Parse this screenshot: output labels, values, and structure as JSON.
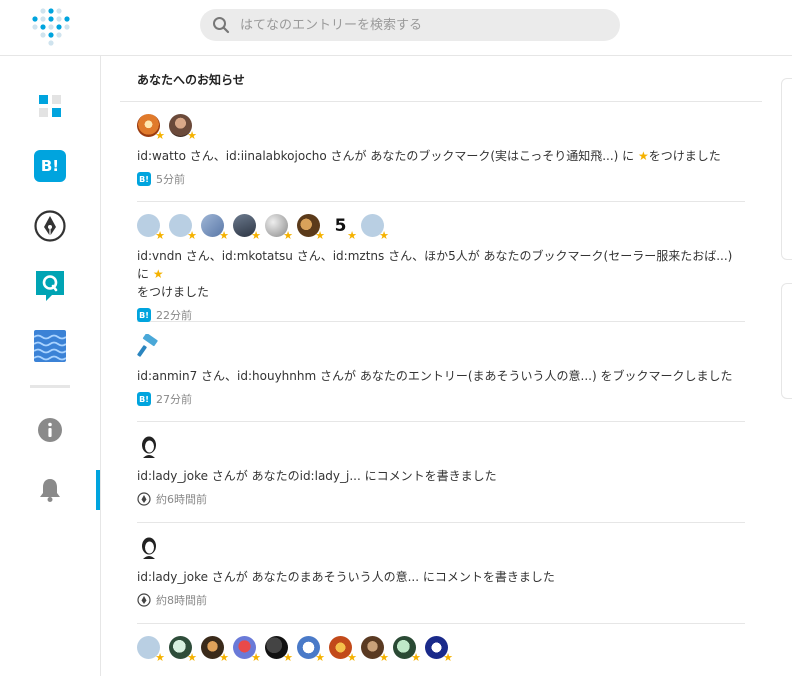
{
  "header": {
    "logo_icon": "hatena-dots-logo",
    "search_placeholder": "はてなのエントリーを検索する",
    "search_icon": "search-icon"
  },
  "sidebar": {
    "items": [
      {
        "name": "top",
        "icon": "hatena-top-icon"
      },
      {
        "name": "bookmark",
        "icon": "hatena-bookmark-icon"
      },
      {
        "name": "blog",
        "icon": "pen-nib-icon"
      },
      {
        "name": "question",
        "icon": "hatena-question-icon"
      },
      {
        "name": "haiku",
        "icon": "wave-pattern-icon"
      },
      {
        "name": "info",
        "icon": "info-icon"
      },
      {
        "name": "notifications",
        "icon": "bell-icon",
        "active": true
      }
    ],
    "accent": "#00a4de"
  },
  "main": {
    "title": "あなたへのお知らせ",
    "notifications": [
      {
        "message": "id:watto さん、id:iinalabkojocho さんが あなたのブックマーク(実はこっそり通知飛...) に",
        "star": "★",
        "suffix": "をつけました",
        "badge": "B!",
        "time": "5分前"
      },
      {
        "message": "id:vndn さん、id:mkotatsu さん、id:mztns さん、ほか5人が あなたのブックマーク(セーラー服来たおば...) に",
        "star": "★",
        "suffix": "をつけました",
        "badge": "B!",
        "time": "22分前"
      },
      {
        "message": "id:anmin7 さん、id:houyhnhm さんが あなたのエントリー(まあそういう人の意...) をブックマークしました",
        "badge": "B!",
        "time": "27分前"
      },
      {
        "message": "id:lady_joke さんが あなたのid:lady_j... にコメントを書きました",
        "time": "約6時間前"
      },
      {
        "message": "id:lady_joke さんが あなたのまあそういう人の意... にコメントを書きました",
        "time": "約8時間前"
      }
    ],
    "avatar_star": "★",
    "star_color": "#f5b200"
  }
}
